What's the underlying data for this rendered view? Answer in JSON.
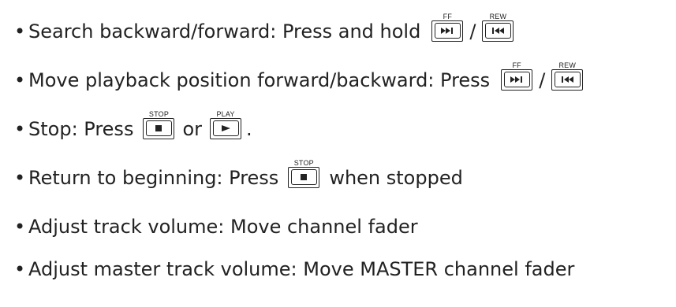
{
  "bullet_glyph": "•",
  "items": [
    {
      "text": "Search backward/forward: Press and hold",
      "key1_label": "FF",
      "separator": "/",
      "key2_label": "REW"
    },
    {
      "text": "Move playback position forward/backward: Press",
      "key1_label": "FF",
      "separator": "/",
      "key2_label": "REW"
    },
    {
      "text": "Stop: Press",
      "key1_label": "STOP",
      "separator": "or",
      "key2_label": "PLAY",
      "suffix": "."
    },
    {
      "text": "Return to beginning: Press",
      "key1_label": "STOP",
      "suffix": "when stopped"
    },
    {
      "text": "Adjust track volume: Move channel fader"
    },
    {
      "text": "Adjust master track volume: Move MASTER channel fader"
    }
  ],
  "icons": {
    "ff": "fast-forward-icon",
    "rew": "rewind-icon",
    "stop": "stop-icon",
    "play": "play-icon"
  }
}
